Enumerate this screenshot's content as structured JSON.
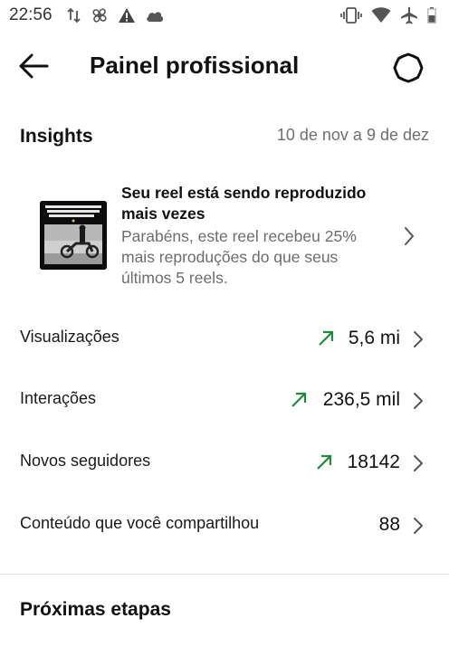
{
  "status_bar": {
    "time": "22:56",
    "left_icons": [
      "data-transfer-icon",
      "pinwheel-icon",
      "warning-icon",
      "cloud-icon"
    ],
    "right_icons": [
      "vibrate-icon",
      "wifi-icon",
      "airplane-icon",
      "battery-icon"
    ]
  },
  "header": {
    "title": "Painel profissional",
    "back_icon": "back-arrow-icon",
    "settings_icon": "settings-gear-icon"
  },
  "insights": {
    "title": "Insights",
    "date_range": "10 de nov a 9 de dez"
  },
  "reel_card": {
    "title": "Seu reel está sendo reproduzido mais vezes",
    "description": "Parabéns, este reel recebeu 25% mais reproduções do que seus últimos 5 reels.",
    "thumbnail": "motorcycle-reel-thumbnail"
  },
  "metrics": [
    {
      "label": "Visualizações",
      "value": "5,6 mi",
      "trend": "up"
    },
    {
      "label": "Interações",
      "value": "236,5 mil",
      "trend": "up"
    },
    {
      "label": "Novos seguidores",
      "value": "18142",
      "trend": "up"
    },
    {
      "label": "Conteúdo que você compartilhou",
      "value": "88",
      "trend": "none"
    }
  ],
  "next_steps": {
    "title": "Próximas etapas"
  },
  "colors": {
    "trend_up": "#1f8a3a",
    "secondary_text": "#6d6d6d",
    "divider": "#e3e3e3"
  }
}
